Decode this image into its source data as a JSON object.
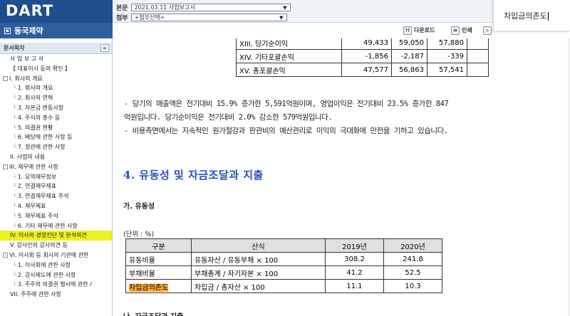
{
  "header": {
    "logo_text": "DART",
    "doc_label": "본문",
    "doc_value": "2021.03.11 사업보고서",
    "attach_label": "첨부",
    "attach_value": "+첨부선택+",
    "download_label": "다운로드",
    "print_label": "인쇄"
  },
  "company": "동국제약",
  "sidebar": {
    "title": "문서목차",
    "collapse_symbol": "«",
    "items": [
      {
        "label": "사 업 보 고 서",
        "level": 0,
        "toggle": ""
      },
      {
        "label": "【 대표이사 등의 확인 】",
        "level": 0,
        "toggle": ""
      },
      {
        "label": "I. 회사의 개요",
        "level": 0,
        "toggle": "-"
      },
      {
        "label": "1. 회사의 개요",
        "level": 1,
        "toggle": ""
      },
      {
        "label": "2. 회사의 연혁",
        "level": 1,
        "toggle": ""
      },
      {
        "label": "3. 자본금 변동사항",
        "level": 1,
        "toggle": ""
      },
      {
        "label": "4. 주식의 총수 등",
        "level": 1,
        "toggle": ""
      },
      {
        "label": "5. 의결권 현황",
        "level": 1,
        "toggle": ""
      },
      {
        "label": "6. 배당에 관한 사항 등",
        "level": 1,
        "toggle": ""
      },
      {
        "label": "7. 정관에 관한 사항",
        "level": 1,
        "toggle": ""
      },
      {
        "label": "II. 사업의 내용",
        "level": 0,
        "toggle": ""
      },
      {
        "label": "III. 재무에 관한 사항",
        "level": 0,
        "toggle": "-"
      },
      {
        "label": "1. 요약재무정보",
        "level": 1,
        "toggle": ""
      },
      {
        "label": "2. 연결재무제표",
        "level": 1,
        "toggle": ""
      },
      {
        "label": "3. 연결재무제표 주석",
        "level": 1,
        "toggle": ""
      },
      {
        "label": "4. 재무제표",
        "level": 1,
        "toggle": ""
      },
      {
        "label": "5. 재무제표 주석",
        "level": 1,
        "toggle": ""
      },
      {
        "label": "6. 기타 재무에 관한 사항",
        "level": 1,
        "toggle": ""
      },
      {
        "label": "IV. 이사의 경영진단 및 분석의견",
        "level": 0,
        "toggle": "",
        "highlight": true
      },
      {
        "label": "V. 감사인의 감사의견 등",
        "level": 0,
        "toggle": ""
      },
      {
        "label": "VI. 이사회 등 회사의 기관에 관한",
        "level": 0,
        "toggle": "-"
      },
      {
        "label": "1. 이사회에 관한 사항",
        "level": 1,
        "toggle": ""
      },
      {
        "label": "2. 감사제도에 관한 사항",
        "level": 1,
        "toggle": ""
      },
      {
        "label": "3. 주주의 의결권 행사에 관한 /",
        "level": 1,
        "toggle": ""
      },
      {
        "label": "VII. 주주에 관한 사항",
        "level": 0,
        "toggle": ""
      }
    ]
  },
  "top_table": {
    "rows": [
      [
        "XIII. 당기순이익",
        "49,433",
        "59,050",
        "57,880",
        ""
      ],
      [
        "XIV. 기타포괄손익",
        "-1,856",
        "-2,187",
        "-339",
        ""
      ],
      [
        "XV. 총포괄손익",
        "47,577",
        "56,863",
        "57,541",
        ""
      ]
    ]
  },
  "paragraph1": "- 당기의 매출액은 전기대비 15.9% 증가한 5,591억원이며, 영업이익은 전기대비 23.5% 증가한 847억원입니다. 당기순이익은 전기대비 2.0% 감소한 579억원입니다.",
  "paragraph2": "- 비용측면에서는 지속적인 원가절감과 판관비의 예산관리로 이익의 극대화에 만전을 기하고 있습니다.",
  "section4_title": "4. 유동성 및 자금조달과 지출",
  "subsection_a": "가. 유동성",
  "unit_note": "(단위 : %)",
  "liquidity_table": {
    "headers": [
      "구분",
      "산식",
      "2019년",
      "2020년"
    ],
    "rows": [
      {
        "name": "유동비율",
        "formula": "유동자산 / 유동부채 × 100",
        "y2019": "308.2",
        "y2020": "241.8",
        "highlight": false
      },
      {
        "name": "부채비율",
        "formula": "부채총계 / 자기자본 × 100",
        "y2019": "41.2",
        "y2020": "52.5",
        "highlight": false
      },
      {
        "name": "차입금의존도",
        "formula": "차입금 / 총자산 × 100",
        "y2019": "11.1",
        "y2020": "10.3",
        "highlight": true
      }
    ]
  },
  "subsection_b": "나. 자금조달과 지출",
  "find_box": {
    "query": "차입금의존도"
  }
}
